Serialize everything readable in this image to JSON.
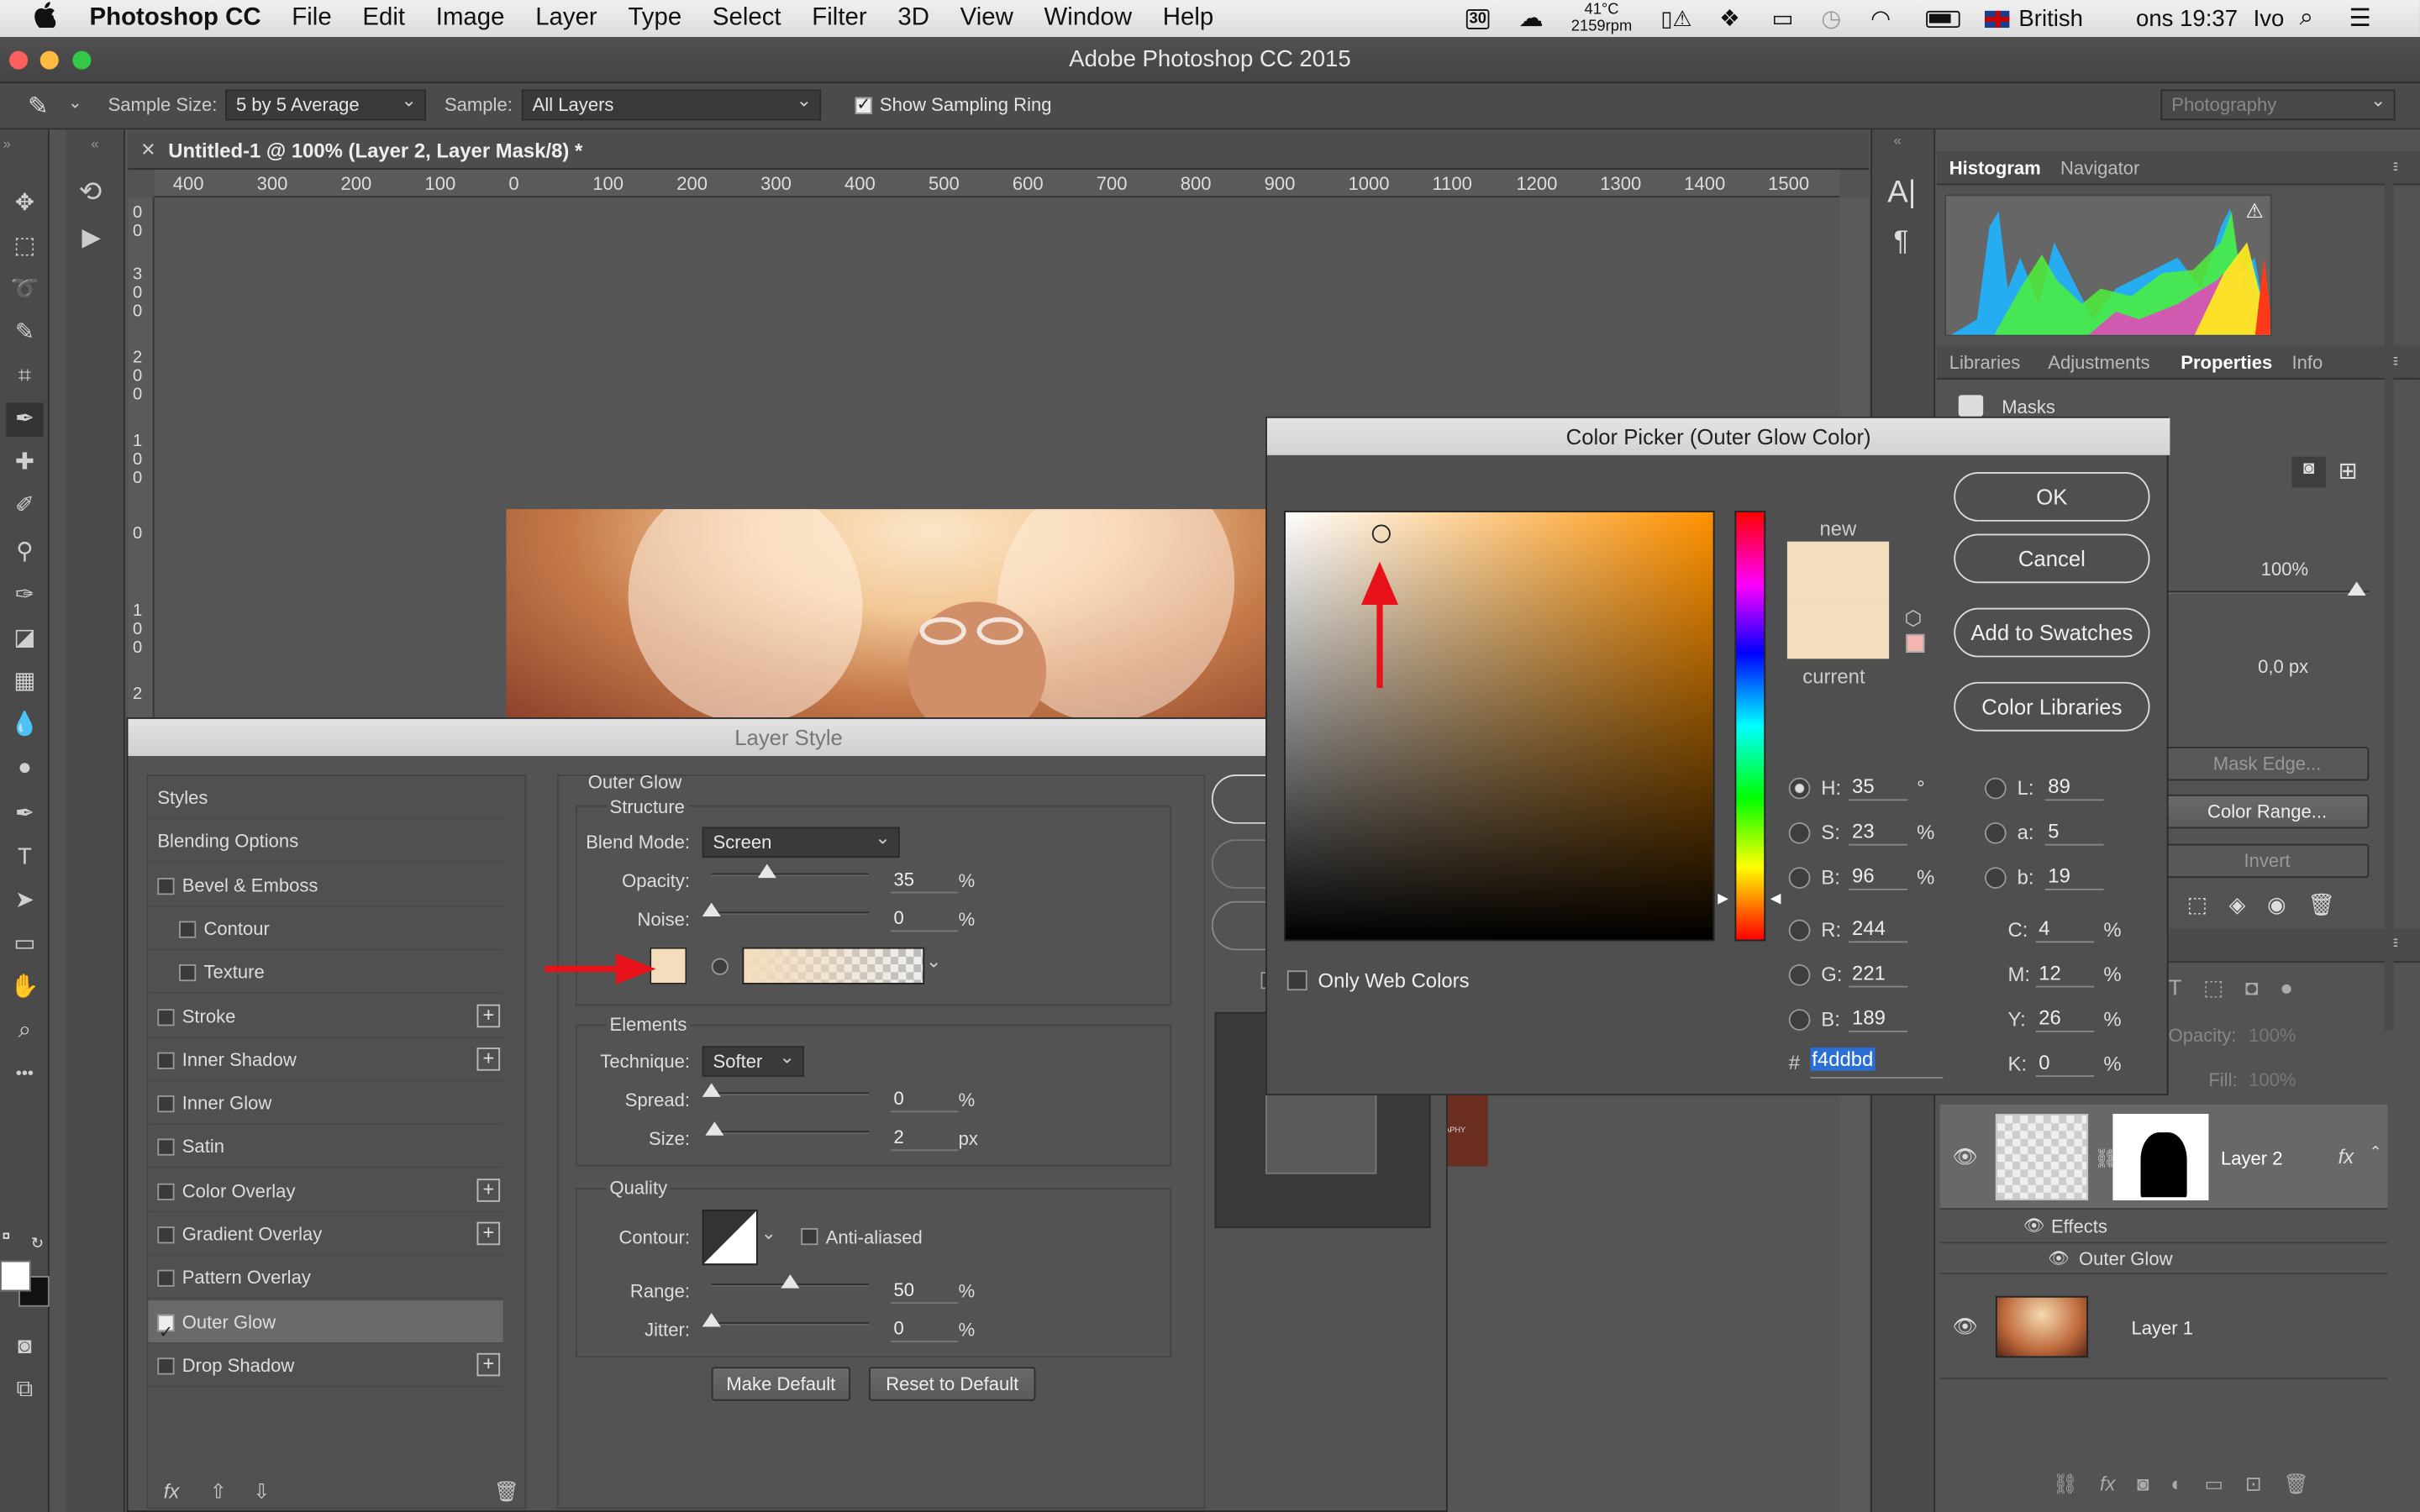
{
  "menubar": {
    "apple": "",
    "app": "Photoshop CC",
    "items": [
      "File",
      "Edit",
      "Image",
      "Layer",
      "Type",
      "Select",
      "Filter",
      "3D",
      "View",
      "Window",
      "Help"
    ],
    "calendar": "30",
    "temp": "41°C",
    "rpm": "2159rpm",
    "language": "British",
    "clock": "ons 19:37",
    "user": "Ivo"
  },
  "window": {
    "title": "Adobe Photoshop CC 2015"
  },
  "options": {
    "sample_size_label": "Sample Size:",
    "sample_size_value": "5 by 5 Average",
    "sample_label": "Sample:",
    "sample_value": "All Layers",
    "show_ring_label": "Show Sampling Ring",
    "workspace": "Photography"
  },
  "document": {
    "tab_title": "Untitled-1 @ 100% (Layer 2, Layer Mask/8) *",
    "ruler_h": [
      "400",
      "300",
      "200",
      "100",
      "0",
      "100",
      "200",
      "300",
      "400",
      "500",
      "600",
      "700",
      "800",
      "900",
      "1000",
      "1100",
      "1200",
      "1300",
      "1400",
      "1500"
    ],
    "ruler_v": [
      "0",
      "0",
      "3",
      "0",
      "0",
      "2",
      "0",
      "0",
      "1",
      "0",
      "0",
      "0",
      "1",
      "0",
      "0",
      "2"
    ]
  },
  "tools": [
    "move-icon",
    "marquee-icon",
    "lasso-icon",
    "quick-select-icon",
    "crop-icon",
    "eyedropper-icon",
    "healing-icon",
    "brush-icon",
    "clone-stamp-icon",
    "history-brush-icon",
    "eraser-icon",
    "gradient-icon",
    "blur-icon",
    "dodge-icon",
    "pen-icon",
    "type-icon",
    "path-select-icon",
    "shape-icon",
    "hand-icon",
    "zoom-icon",
    "more-icon"
  ],
  "right_panel": {
    "tabs_top": [
      "Histogram",
      "Navigator"
    ],
    "tabs_mid": [
      "Libraries",
      "Adjustments",
      "Properties",
      "Info"
    ],
    "masks_label": "Masks",
    "density": "100%",
    "feather": "0,0 px",
    "mask_edge": "Mask Edge...",
    "color_range": "Color Range...",
    "invert": "Invert",
    "opacity_label": "Opacity:",
    "opacity_value": "100%",
    "fill_label": "Fill:",
    "fill_value": "100%"
  },
  "layers": {
    "layer2": "Layer 2",
    "effects": "Effects",
    "outer_glow": "Outer Glow",
    "layer1": "Layer 1",
    "fx": "fx"
  },
  "layer_style": {
    "title": "Layer Style",
    "items": [
      {
        "label": "Styles",
        "check": false,
        "plus": false,
        "indent": false,
        "nocheck": true
      },
      {
        "label": "Blending Options",
        "check": false,
        "plus": false,
        "indent": false,
        "nocheck": true
      },
      {
        "label": "Bevel & Emboss",
        "check": false,
        "plus": false,
        "indent": false
      },
      {
        "label": "Contour",
        "check": false,
        "plus": false,
        "indent": true
      },
      {
        "label": "Texture",
        "check": false,
        "plus": false,
        "indent": true
      },
      {
        "label": "Stroke",
        "check": false,
        "plus": true,
        "indent": false
      },
      {
        "label": "Inner Shadow",
        "check": false,
        "plus": true,
        "indent": false
      },
      {
        "label": "Inner Glow",
        "check": false,
        "plus": false,
        "indent": false
      },
      {
        "label": "Satin",
        "check": false,
        "plus": false,
        "indent": false
      },
      {
        "label": "Color Overlay",
        "check": false,
        "plus": true,
        "indent": false
      },
      {
        "label": "Gradient Overlay",
        "check": false,
        "plus": true,
        "indent": false
      },
      {
        "label": "Pattern Overlay",
        "check": false,
        "plus": false,
        "indent": false
      },
      {
        "label": "Outer Glow",
        "check": true,
        "plus": false,
        "indent": false,
        "selected": true
      },
      {
        "label": "Drop Shadow",
        "check": false,
        "plus": true,
        "indent": false
      }
    ],
    "section": "Outer Glow",
    "structure": "Structure",
    "blend_mode_label": "Blend Mode:",
    "blend_mode": "Screen",
    "opacity_label": "Opacity:",
    "opacity": "35",
    "noise_label": "Noise:",
    "noise": "0",
    "pct": "%",
    "px": "px",
    "elements": "Elements",
    "technique_label": "Technique:",
    "technique": "Softer",
    "spread_label": "Spread:",
    "spread": "0",
    "size_label": "Size:",
    "size": "2",
    "quality": "Quality",
    "contour_label": "Contour:",
    "anti_aliased": "Anti-aliased",
    "range_label": "Range:",
    "range": "50",
    "jitter_label": "Jitter:",
    "jitter": "0",
    "make_default": "Make Default",
    "reset_default": "Reset to Default",
    "glow_color": "#f4ddbd"
  },
  "color_picker": {
    "title": "Color Picker (Outer Glow Color)",
    "ok": "OK",
    "cancel": "Cancel",
    "add_swatches": "Add to Swatches",
    "color_libraries": "Color Libraries",
    "new_label": "new",
    "current_label": "current",
    "new_color": "#f4ddbd",
    "current_color": "#f4ddbd",
    "only_web": "Only Web Colors",
    "H": "35",
    "S": "23",
    "B": "96",
    "R": "244",
    "G": "221",
    "Bb": "189",
    "L": "89",
    "a": "5",
    "b": "19",
    "C": "4",
    "M": "12",
    "Y": "26",
    "K": "0",
    "hex": "f4ddbd",
    "deg": "°",
    "pct": "%",
    "labels": {
      "H": "H:",
      "S": "S:",
      "B": "B:",
      "R": "R:",
      "G": "G:",
      "Bb": "B:",
      "L": "L:",
      "a": "a:",
      "b": "b:",
      "C": "C:",
      "M": "M:",
      "Y": "Y:",
      "K": "K:",
      "hash": "#"
    }
  },
  "annotation_color": "#e8121b"
}
